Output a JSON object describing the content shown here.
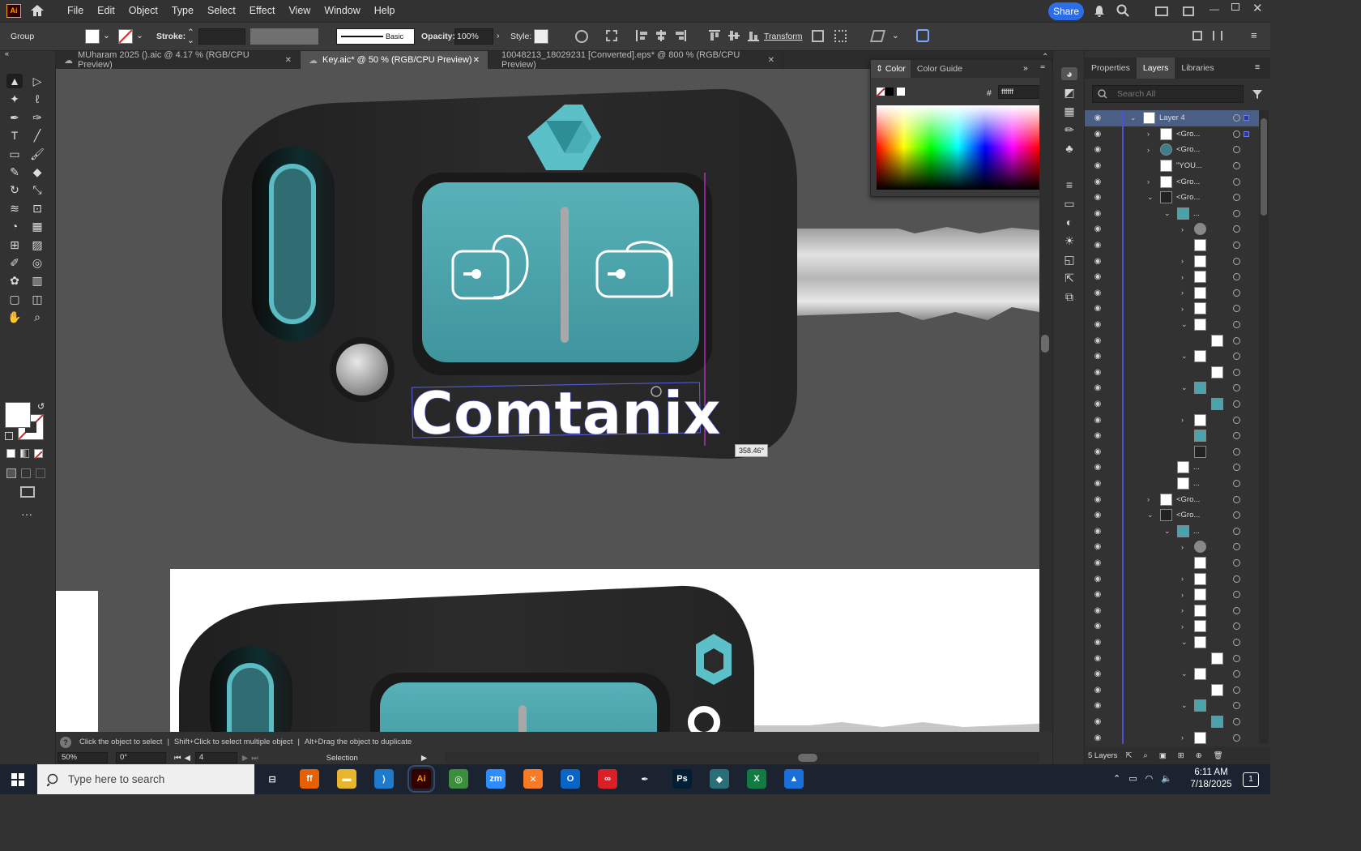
{
  "app": {
    "logo": "Ai"
  },
  "menu": [
    "File",
    "Edit",
    "Object",
    "Type",
    "Select",
    "Effect",
    "View",
    "Window",
    "Help"
  ],
  "share_label": "Share",
  "control": {
    "selection_type": "Group",
    "stroke_label": "Stroke:",
    "stroke_profile": "Basic",
    "opacity_label": "Opacity:",
    "opacity_value": "100%",
    "style_label": "Style:",
    "transform_label": "Transform"
  },
  "tabs": [
    {
      "label": "MUharam 2025 ().aic @ 4.17 % (RGB/CPU Preview)",
      "active": false
    },
    {
      "label": "Key.aic* @ 50 % (RGB/CPU Preview)",
      "active": true
    },
    {
      "label": "10048213_18029231 [Converted].eps* @ 800 % (RGB/CPU Preview)",
      "active": false
    }
  ],
  "artboard": {
    "brand_text": "Comtanix",
    "rotation_tooltip": "358.46°"
  },
  "color_panel": {
    "tab_color": "Color",
    "tab_guide": "Color Guide",
    "hex_label": "#",
    "hex_value": "ffffff"
  },
  "right_panel": {
    "tabs": [
      "Properties",
      "Layers",
      "Libraries"
    ],
    "search_placeholder": "Search All",
    "layer_name": "Layer 4",
    "footer_count": "5 Layers"
  },
  "layers": [
    {
      "indent": 0,
      "label": "Layer 4",
      "chevron": "v",
      "thumb": "white"
    },
    {
      "indent": 1,
      "label": "<Gro...",
      "chevron": ">",
      "thumb": "white"
    },
    {
      "indent": 1,
      "label": "<Gro...",
      "chevron": ">",
      "thumb": "globe"
    },
    {
      "indent": 1,
      "label": "\"YOU...",
      "chevron": "",
      "thumb": "white"
    },
    {
      "indent": 1,
      "label": "<Gro...",
      "chevron": ">",
      "thumb": "white"
    },
    {
      "indent": 1,
      "label": "<Gro...",
      "chevron": "v",
      "thumb": "dark"
    },
    {
      "indent": 2,
      "label": "...",
      "chevron": "v",
      "thumb": "teal"
    },
    {
      "indent": 3,
      "label": "",
      "chevron": ">",
      "thumb": "gray"
    },
    {
      "indent": 3,
      "label": "",
      "chevron": "",
      "thumb": "white"
    },
    {
      "indent": 3,
      "label": "",
      "chevron": ">",
      "thumb": "white"
    },
    {
      "indent": 3,
      "label": "",
      "chevron": ">",
      "thumb": "white"
    },
    {
      "indent": 3,
      "label": "",
      "chevron": ">",
      "thumb": "white"
    },
    {
      "indent": 3,
      "label": "",
      "chevron": ">",
      "thumb": "white"
    },
    {
      "indent": 3,
      "label": "",
      "chevron": "v",
      "thumb": "white"
    },
    {
      "indent": 4,
      "label": "",
      "chevron": "",
      "thumb": "white"
    },
    {
      "indent": 3,
      "label": "",
      "chevron": "v",
      "thumb": "white"
    },
    {
      "indent": 4,
      "label": "",
      "chevron": "",
      "thumb": "white"
    },
    {
      "indent": 3,
      "label": "",
      "chevron": "v",
      "thumb": "teal"
    },
    {
      "indent": 4,
      "label": "",
      "chevron": "",
      "thumb": "teal"
    },
    {
      "indent": 3,
      "label": "",
      "chevron": ">",
      "thumb": "white"
    },
    {
      "indent": 3,
      "label": "",
      "chevron": "",
      "thumb": "teal"
    },
    {
      "indent": 3,
      "label": "",
      "chevron": "",
      "thumb": "dark"
    },
    {
      "indent": 2,
      "label": "...",
      "chevron": "",
      "thumb": "white"
    },
    {
      "indent": 2,
      "label": "...",
      "chevron": "",
      "thumb": "white"
    },
    {
      "indent": 1,
      "label": "<Gro...",
      "chevron": ">",
      "thumb": "white"
    },
    {
      "indent": 1,
      "label": "<Gro...",
      "chevron": "v",
      "thumb": "dark"
    },
    {
      "indent": 2,
      "label": "...",
      "chevron": "v",
      "thumb": "teal"
    },
    {
      "indent": 3,
      "label": "",
      "chevron": ">",
      "thumb": "gray"
    },
    {
      "indent": 3,
      "label": "",
      "chevron": "",
      "thumb": "white"
    },
    {
      "indent": 3,
      "label": "",
      "chevron": ">",
      "thumb": "white"
    },
    {
      "indent": 3,
      "label": "",
      "chevron": ">",
      "thumb": "white"
    },
    {
      "indent": 3,
      "label": "",
      "chevron": ">",
      "thumb": "white"
    },
    {
      "indent": 3,
      "label": "",
      "chevron": ">",
      "thumb": "white"
    },
    {
      "indent": 3,
      "label": "",
      "chevron": "v",
      "thumb": "white"
    },
    {
      "indent": 4,
      "label": "",
      "chevron": "",
      "thumb": "white"
    },
    {
      "indent": 3,
      "label": "",
      "chevron": "v",
      "thumb": "white"
    },
    {
      "indent": 4,
      "label": "",
      "chevron": "",
      "thumb": "white"
    },
    {
      "indent": 3,
      "label": "",
      "chevron": "v",
      "thumb": "teal"
    },
    {
      "indent": 4,
      "label": "",
      "chevron": "",
      "thumb": "teal"
    },
    {
      "indent": 3,
      "label": "",
      "chevron": ">",
      "thumb": "white"
    }
  ],
  "status": {
    "hint1": "Click the object to select",
    "hint2": "Shift+Click to select multiple object",
    "hint3": "Alt+Drag the object to duplicate",
    "zoom": "50%",
    "rotate": "0°",
    "artboard_num": "4",
    "tool": "Selection"
  },
  "taskbar": {
    "search_placeholder": "Type here to search",
    "time": "6:11 AM",
    "date": "7/18/2025",
    "notif": "1"
  },
  "colors": {
    "teal": "#4aa3ab",
    "key_body": "#252525",
    "accent": "#2d6ee8"
  }
}
